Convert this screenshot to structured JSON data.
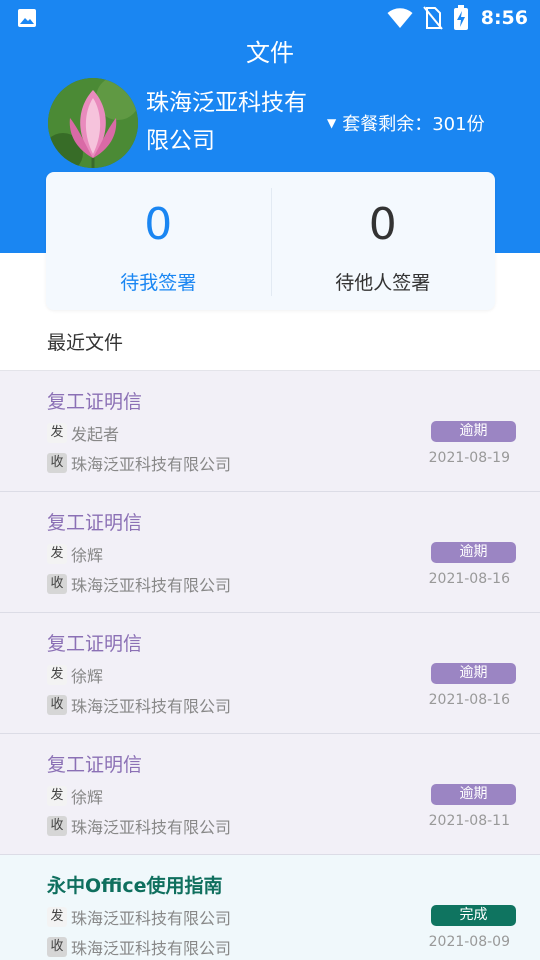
{
  "status_bar": {
    "time": "8:56",
    "icons": [
      "gallery-icon",
      "wifi-icon",
      "no-sim-icon",
      "battery-charging-icon"
    ]
  },
  "header": {
    "title": "文件"
  },
  "profile": {
    "company": "珠海泛亚科技有限公司",
    "plan": "套餐剩余：301份",
    "plan_icon": "caret-down-icon"
  },
  "sign_stats": {
    "mine": {
      "count": "0",
      "label": "待我签署"
    },
    "others": {
      "count": "0",
      "label": "待他人签署"
    }
  },
  "recent": {
    "title": "最近文件",
    "items": [
      {
        "title": "复工证明信",
        "from_tag": "发",
        "from": "发起者",
        "to_tag": "收",
        "to": "珠海泛亚科技有限公司",
        "status": "逾期",
        "date": "2021-08-19"
      },
      {
        "title": "复工证明信",
        "from_tag": "发",
        "from": "徐辉",
        "to_tag": "收",
        "to": "珠海泛亚科技有限公司",
        "status": "逾期",
        "date": "2021-08-16"
      },
      {
        "title": "复工证明信",
        "from_tag": "发",
        "from": "徐辉",
        "to_tag": "收",
        "to": "珠海泛亚科技有限公司",
        "status": "逾期",
        "date": "2021-08-16"
      },
      {
        "title": "复工证明信",
        "from_tag": "发",
        "from": "徐辉",
        "to_tag": "收",
        "to": "珠海泛亚科技有限公司",
        "status": "逾期",
        "date": "2021-08-11"
      },
      {
        "title": "永中Office使用指南",
        "from_tag": "发",
        "from": "珠海泛亚科技有限公司",
        "to_tag": "收",
        "to": "珠海泛亚科技有限公司",
        "status": "完成",
        "date": "2021-08-09"
      }
    ]
  },
  "colors": {
    "primary": "#1a86f2",
    "overdue": "#9b85c3",
    "done": "#0f7460"
  }
}
